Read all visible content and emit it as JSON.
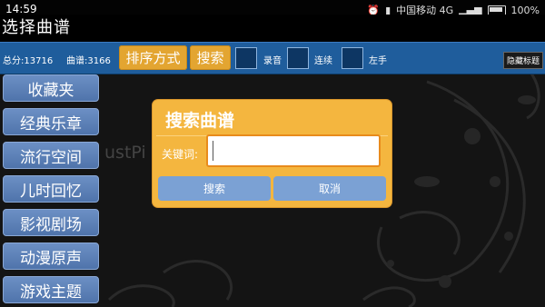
{
  "status_bar": {
    "time": "14:59",
    "carrier": "中国移动 4G",
    "battery": "100%"
  },
  "app": {
    "title": "选择曲谱"
  },
  "toolbar": {
    "total_label": "总分:13716",
    "score_label": "曲谱:3166",
    "sort_button": "排序方式",
    "search_button": "搜索",
    "record_label": "录音",
    "continuous_label": "连续",
    "left_hand_label": "左手",
    "hide_title_button": "隐藏标题"
  },
  "sidebar": {
    "items": [
      "收藏夹",
      "经典乐章",
      "流行空间",
      "儿时回忆",
      "影视剧场",
      "动漫原声",
      "游戏主题"
    ]
  },
  "background_text": "ustPi",
  "dialog": {
    "title": "搜索曲谱",
    "keyword_label": "关键词:",
    "keyword_value": "",
    "search_button": "搜索",
    "cancel_button": "取消"
  },
  "colors": {
    "toolbar": "#1f5d9c",
    "accent": "#e3a531",
    "dialog": "#f4b63f",
    "category": "#5a7fb6"
  }
}
